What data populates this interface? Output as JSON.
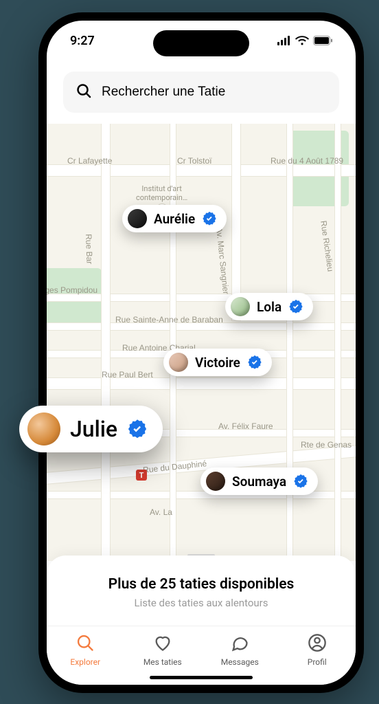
{
  "status": {
    "time": "9:27"
  },
  "search": {
    "placeholder": "Rechercher une Tatie"
  },
  "map": {
    "streets": [
      "Cr Lafayette",
      "Cr Tolstoï",
      "Rue du 4 Août 1789",
      "Av. Marc Sangnier",
      "Rue Richelieu",
      "Rue Bar",
      "eorges Pompidou",
      "Rue Sainte-Anne de Baraban",
      "Rue Antoine Charial",
      "Rue Paul Bert",
      "Av. Félix Faure",
      "Rte de Genas",
      "Rue du Dauphiné",
      "Av. La"
    ],
    "poi": {
      "institut": "Institut d'art\ncontemporain…"
    },
    "transit": "T"
  },
  "pins": [
    {
      "name": "Aurélie",
      "verified": true
    },
    {
      "name": "Lola",
      "verified": true
    },
    {
      "name": "Victoire",
      "verified": true
    },
    {
      "name": "Soumaya",
      "verified": true
    }
  ],
  "feature_pin": {
    "name": "Julie",
    "verified": true
  },
  "sheet": {
    "title": "Plus de 25 taties disponibles",
    "subtitle": "Liste des taties aux alentours"
  },
  "tabs": {
    "explore": "Explorer",
    "mytaties": "Mes taties",
    "messages": "Messages",
    "profile": "Profil"
  }
}
